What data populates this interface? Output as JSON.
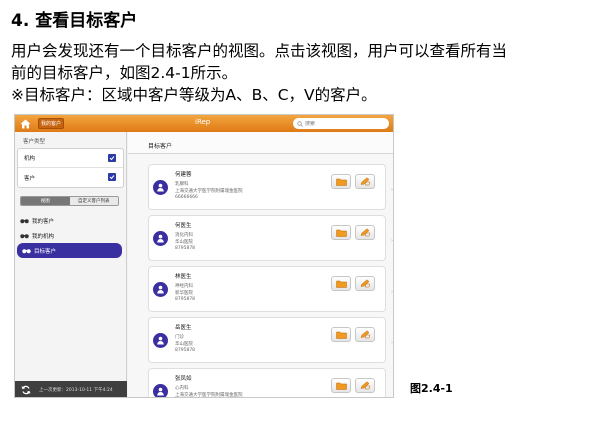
{
  "document": {
    "heading": "4. 查看目标客户",
    "para_line1": "用户会发现还有一个目标客户的视图。点击该视图，用户可以查看所有当",
    "para_line2": "前的目标客户，如图2.4-1所示。",
    "para_line3": "※目标客户：区域中客户等级为A、B、C，V的客户。",
    "figure_caption": "图2.4-1"
  },
  "app": {
    "title": "iRep",
    "top_tab": "我的客户",
    "search_placeholder": "搜索",
    "colors": {
      "toolbar": "#e8891f",
      "accent": "#3a2fa0"
    },
    "sidebar": {
      "section_title": "客户类型",
      "filters": [
        {
          "label": "机构",
          "checked": true
        },
        {
          "label": "客户",
          "checked": true
        }
      ],
      "segments": [
        "视图",
        "自定义客户列表"
      ],
      "views": [
        {
          "label": "我的客户",
          "icon": "binoculars-icon"
        },
        {
          "label": "我的机构",
          "icon": "binoculars-icon"
        },
        {
          "label": "目标客户",
          "icon": "binoculars-icon",
          "active": true
        }
      ],
      "footer_text": "上一次更新：2013-10-11 下午4:24"
    },
    "main": {
      "title": "目标客户",
      "customers": [
        {
          "name": "何建蓉",
          "line1": "乳腺科",
          "line2": "上海交通大学医学院附属瑞金医院",
          "line3": "66666666"
        },
        {
          "name": "何医生",
          "line1": "消化内科",
          "line2": "华山医院",
          "line3": "8795878"
        },
        {
          "name": "林医生",
          "line1": "神经内科",
          "line2": "新华医院",
          "line3": "8795878"
        },
        {
          "name": "岳医生",
          "line1": "门诊",
          "line2": "华山医院",
          "line3": "8795878"
        },
        {
          "name": "张凤如",
          "line1": "心内科",
          "line2": "上海交通大学医学院附属瑞金医院",
          "line3": "66666666"
        }
      ]
    }
  }
}
